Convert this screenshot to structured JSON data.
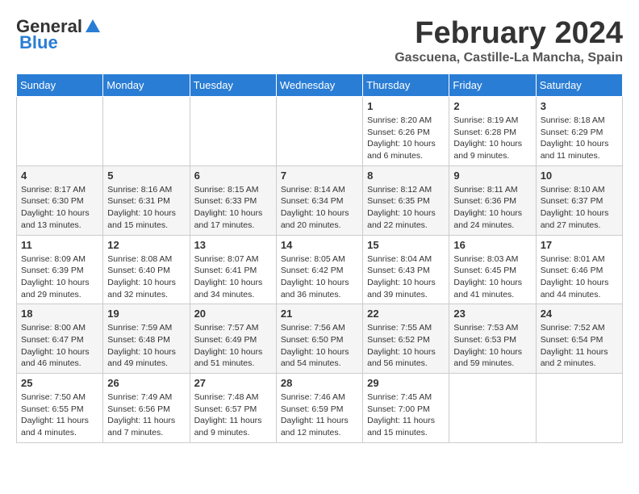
{
  "header": {
    "logo_general": "General",
    "logo_blue": "Blue",
    "month_title": "February 2024",
    "location": "Gascuena, Castille-La Mancha, Spain"
  },
  "calendar": {
    "days_of_week": [
      "Sunday",
      "Monday",
      "Tuesday",
      "Wednesday",
      "Thursday",
      "Friday",
      "Saturday"
    ],
    "weeks": [
      [
        {
          "day": "",
          "info": ""
        },
        {
          "day": "",
          "info": ""
        },
        {
          "day": "",
          "info": ""
        },
        {
          "day": "",
          "info": ""
        },
        {
          "day": "1",
          "info": "Sunrise: 8:20 AM\nSunset: 6:26 PM\nDaylight: 10 hours\nand 6 minutes."
        },
        {
          "day": "2",
          "info": "Sunrise: 8:19 AM\nSunset: 6:28 PM\nDaylight: 10 hours\nand 9 minutes."
        },
        {
          "day": "3",
          "info": "Sunrise: 8:18 AM\nSunset: 6:29 PM\nDaylight: 10 hours\nand 11 minutes."
        }
      ],
      [
        {
          "day": "4",
          "info": "Sunrise: 8:17 AM\nSunset: 6:30 PM\nDaylight: 10 hours\nand 13 minutes."
        },
        {
          "day": "5",
          "info": "Sunrise: 8:16 AM\nSunset: 6:31 PM\nDaylight: 10 hours\nand 15 minutes."
        },
        {
          "day": "6",
          "info": "Sunrise: 8:15 AM\nSunset: 6:33 PM\nDaylight: 10 hours\nand 17 minutes."
        },
        {
          "day": "7",
          "info": "Sunrise: 8:14 AM\nSunset: 6:34 PM\nDaylight: 10 hours\nand 20 minutes."
        },
        {
          "day": "8",
          "info": "Sunrise: 8:12 AM\nSunset: 6:35 PM\nDaylight: 10 hours\nand 22 minutes."
        },
        {
          "day": "9",
          "info": "Sunrise: 8:11 AM\nSunset: 6:36 PM\nDaylight: 10 hours\nand 24 minutes."
        },
        {
          "day": "10",
          "info": "Sunrise: 8:10 AM\nSunset: 6:37 PM\nDaylight: 10 hours\nand 27 minutes."
        }
      ],
      [
        {
          "day": "11",
          "info": "Sunrise: 8:09 AM\nSunset: 6:39 PM\nDaylight: 10 hours\nand 29 minutes."
        },
        {
          "day": "12",
          "info": "Sunrise: 8:08 AM\nSunset: 6:40 PM\nDaylight: 10 hours\nand 32 minutes."
        },
        {
          "day": "13",
          "info": "Sunrise: 8:07 AM\nSunset: 6:41 PM\nDaylight: 10 hours\nand 34 minutes."
        },
        {
          "day": "14",
          "info": "Sunrise: 8:05 AM\nSunset: 6:42 PM\nDaylight: 10 hours\nand 36 minutes."
        },
        {
          "day": "15",
          "info": "Sunrise: 8:04 AM\nSunset: 6:43 PM\nDaylight: 10 hours\nand 39 minutes."
        },
        {
          "day": "16",
          "info": "Sunrise: 8:03 AM\nSunset: 6:45 PM\nDaylight: 10 hours\nand 41 minutes."
        },
        {
          "day": "17",
          "info": "Sunrise: 8:01 AM\nSunset: 6:46 PM\nDaylight: 10 hours\nand 44 minutes."
        }
      ],
      [
        {
          "day": "18",
          "info": "Sunrise: 8:00 AM\nSunset: 6:47 PM\nDaylight: 10 hours\nand 46 minutes."
        },
        {
          "day": "19",
          "info": "Sunrise: 7:59 AM\nSunset: 6:48 PM\nDaylight: 10 hours\nand 49 minutes."
        },
        {
          "day": "20",
          "info": "Sunrise: 7:57 AM\nSunset: 6:49 PM\nDaylight: 10 hours\nand 51 minutes."
        },
        {
          "day": "21",
          "info": "Sunrise: 7:56 AM\nSunset: 6:50 PM\nDaylight: 10 hours\nand 54 minutes."
        },
        {
          "day": "22",
          "info": "Sunrise: 7:55 AM\nSunset: 6:52 PM\nDaylight: 10 hours\nand 56 minutes."
        },
        {
          "day": "23",
          "info": "Sunrise: 7:53 AM\nSunset: 6:53 PM\nDaylight: 10 hours\nand 59 minutes."
        },
        {
          "day": "24",
          "info": "Sunrise: 7:52 AM\nSunset: 6:54 PM\nDaylight: 11 hours\nand 2 minutes."
        }
      ],
      [
        {
          "day": "25",
          "info": "Sunrise: 7:50 AM\nSunset: 6:55 PM\nDaylight: 11 hours\nand 4 minutes."
        },
        {
          "day": "26",
          "info": "Sunrise: 7:49 AM\nSunset: 6:56 PM\nDaylight: 11 hours\nand 7 minutes."
        },
        {
          "day": "27",
          "info": "Sunrise: 7:48 AM\nSunset: 6:57 PM\nDaylight: 11 hours\nand 9 minutes."
        },
        {
          "day": "28",
          "info": "Sunrise: 7:46 AM\nSunset: 6:59 PM\nDaylight: 11 hours\nand 12 minutes."
        },
        {
          "day": "29",
          "info": "Sunrise: 7:45 AM\nSunset: 7:00 PM\nDaylight: 11 hours\nand 15 minutes."
        },
        {
          "day": "",
          "info": ""
        },
        {
          "day": "",
          "info": ""
        }
      ]
    ]
  }
}
